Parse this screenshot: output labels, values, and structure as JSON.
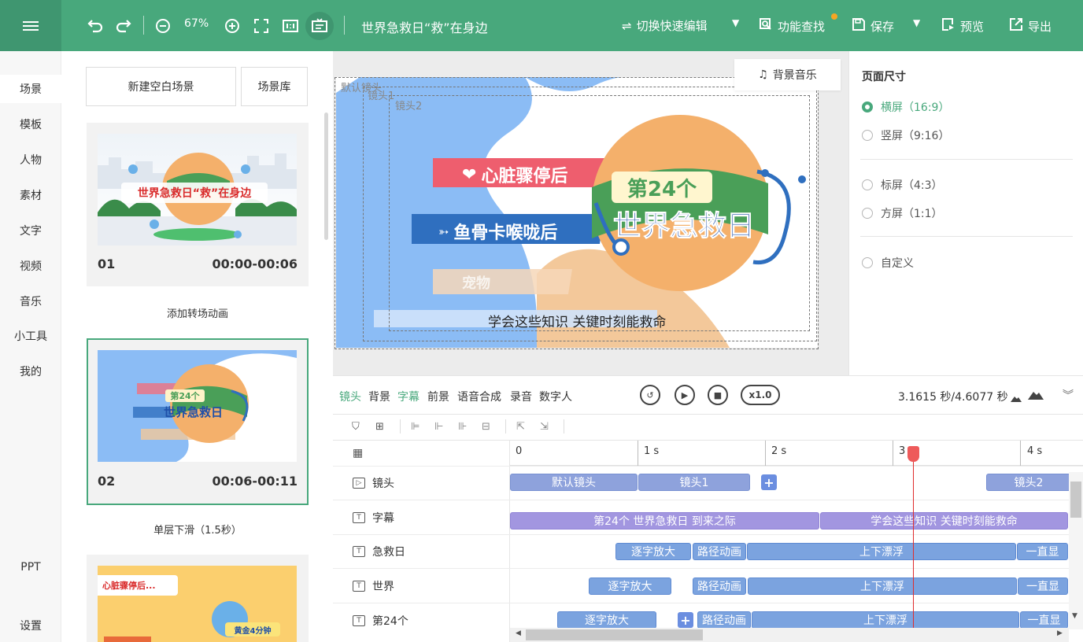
{
  "topbar": {
    "zoom": "67%",
    "title": "世界急救日“救”在身边",
    "quick_edit": "切换快速编辑",
    "feature_search": "功能查找",
    "save": "保存",
    "preview": "预览",
    "export": "导出",
    "accent": "#48a87c"
  },
  "nav": {
    "items": [
      "场景",
      "模板",
      "人物",
      "素材",
      "文字",
      "视频",
      "音乐",
      "小工具",
      "我的"
    ],
    "ppt": "PPT",
    "settings": "设置"
  },
  "scenes": {
    "new_blank": "新建空白场景",
    "library": "场景库",
    "cards": [
      {
        "num": "01",
        "time": "00:00-00:06",
        "thumb_text": "世界急救日“救”在身边"
      },
      {
        "num": "02",
        "time": "00:06-00:11",
        "thumb_badge": "第24个",
        "thumb_text": "世界急救日"
      }
    ],
    "transition1": "添加转场动画",
    "transition2": "单层下滑（1.5秒）",
    "card3": {
      "label": "心脏骤停后...",
      "badge": "黄金4分钟"
    }
  },
  "stage": {
    "default_cam": "默认镜头",
    "cam1": "镜头1",
    "cam2": "镜头2",
    "bgm": "背景音乐",
    "banner1": "心脏骤停后",
    "banner2": "鱼骨卡喉咙后",
    "banner3": "宠物",
    "badge": "第24个",
    "headline": "世界急救日",
    "subtitle": "学会这些知识 关键时刻能救命"
  },
  "page_size": {
    "title": "页面尺寸",
    "options": [
      "横屏（16:9）",
      "竖屏（9:16）",
      "标屏（4:3）",
      "方屏（1:1）",
      "自定义"
    ],
    "selected": 0
  },
  "timeline": {
    "tabs": [
      "镜头",
      "背景",
      "字幕",
      "前景",
      "语音合成",
      "录音",
      "数字人"
    ],
    "active_tabs": [
      0,
      2
    ],
    "speed": "x1.0",
    "time": "3.1615 秒/4.6077 秒",
    "ruler": [
      "0",
      "1 s",
      "2 s",
      "3",
      "4 s"
    ],
    "tracks": [
      "镜头",
      "字幕",
      "急救日",
      "世界",
      "第24个"
    ],
    "cam_clips": [
      "默认镜头",
      "镜头1",
      "镜头2"
    ],
    "sub_clips": [
      "第24个 世界急救日 到来之际",
      "学会这些知识 关键时刻能救命"
    ],
    "fx": {
      "zoom": "逐字放大",
      "path": "路径动画",
      "float": "上下漂浮",
      "show": "一直显"
    }
  }
}
